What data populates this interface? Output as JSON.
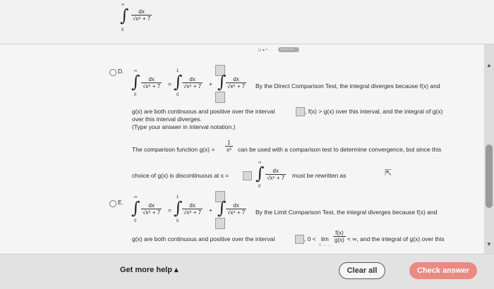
{
  "top": {
    "upper_limit": "∞",
    "lower_limit": "0",
    "num": "dx",
    "den": "√x⁶ + 7"
  },
  "toolbar": {
    "dots_label": "• • • • •",
    "marks": "U ▾ ^  · ·"
  },
  "option_d": {
    "label": "D.",
    "int_upper": "∞",
    "int_lower": "0",
    "mid_upper": "1",
    "mid_lower": "0",
    "num": "dx",
    "den": "√x⁶ + 7",
    "eq": "=",
    "plus": "+",
    "sentence1": "By the Direct Comparison Test, the integral diverges because f(x) and",
    "line2a": "g(x) are both continuous and positive over the interval",
    "line2b": ", f(x) > g(x) over this interval, and the integral of g(x)",
    "line3": "over this interval diverges.",
    "line4": "(Type your answer in interval notation.)",
    "comp_a": "The comparison function g(x) =",
    "comp_num": "1",
    "comp_den": "x³",
    "comp_b": "can be used with a comparison test to determine convergence, but since this",
    "choice_a": "choice of g(x) is discontinuous at x =",
    "choice_b": "must be rewritten as"
  },
  "option_e": {
    "label": "E.",
    "int_upper": "∞",
    "int_lower": "0",
    "mid_upper": "1",
    "mid_lower": "0",
    "num": "dx",
    "den": "√x⁶ + 7",
    "eq": "=",
    "plus": "+",
    "sentence1": "By the Limit Comparison Test, the integral diverges because f(x) and",
    "line2a": "g(x) are both continuous and positive over the interval",
    "line2b": ", 0 <",
    "lim": "lim",
    "lim_sub": "x → ...",
    "lim_num": "f(x)",
    "lim_den": "g(x)",
    "line2c": "< ∞, and the integral of g(x) over this"
  },
  "footer": {
    "help_label": "Get more help ▴",
    "clear_label": "Clear all",
    "check_label": "Check answer"
  }
}
